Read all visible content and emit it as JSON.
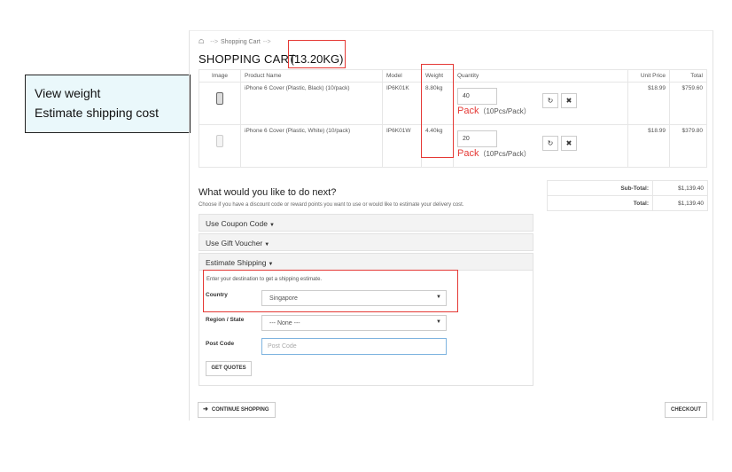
{
  "callout": {
    "line1": "View weight",
    "line2": "Estimate shipping cost"
  },
  "breadcrumb": {
    "home_icon": "home-icon",
    "sep": "-->",
    "current": "Shopping Cart",
    "sep2": "-->"
  },
  "title": "SHOPPING CART",
  "total_weight": "(13.20KG)",
  "table": {
    "headers": {
      "image": "Image",
      "product": "Product Name",
      "model": "Model",
      "weight": "Weight",
      "quantity": "Quantity",
      "unit_price": "Unit Price",
      "total": "Total"
    },
    "rows": [
      {
        "product": "iPhone 6 Cover (Plastic, Black) (10/pack)",
        "model": "IP6K01K",
        "weight": "8.80kg",
        "qty": "40",
        "pack": "Pack",
        "pack_detail": "（10Pcs/Pack）",
        "unit_price": "$18.99",
        "total": "$759.60",
        "thumb_color": "#dddddd"
      },
      {
        "product": "iPhone 6 Cover (Plastic, White) (10/pack)",
        "model": "IP6K01W",
        "weight": "4.40kg",
        "qty": "20",
        "pack": "Pack",
        "pack_detail": "（10Pcs/Pack）",
        "unit_price": "$18.99",
        "total": "$379.80",
        "thumb_color": "#f4f4f4"
      }
    ],
    "update_icon": "refresh-icon",
    "remove_icon": "remove-icon"
  },
  "totals": {
    "subtotal_label": "Sub-Total:",
    "subtotal_value": "$1,139.40",
    "total_label": "Total:",
    "total_value": "$1,139.40"
  },
  "next": {
    "heading": "What would you like to do next?",
    "text": "Choose if you have a discount code or reward points you want to use or would like to estimate your delivery cost."
  },
  "accordion": {
    "coupon": "Use Coupon Code",
    "voucher": "Use Gift Voucher",
    "shipping": "Estimate Shipping"
  },
  "shipping": {
    "hint": "Enter your destination to get a shipping estimate.",
    "country_label": "Country",
    "country_value": "Singapore",
    "region_label": "Region / State",
    "region_value": " --- None --- ",
    "postcode_label": "Post Code",
    "postcode_placeholder": "Post Code",
    "quotes_button": "GET QUOTES"
  },
  "buttons": {
    "continue": "CONTINUE SHOPPING",
    "checkout": "CHECKOUT"
  },
  "colors": {
    "highlight": "#e53935",
    "pack_text": "#e53935"
  }
}
